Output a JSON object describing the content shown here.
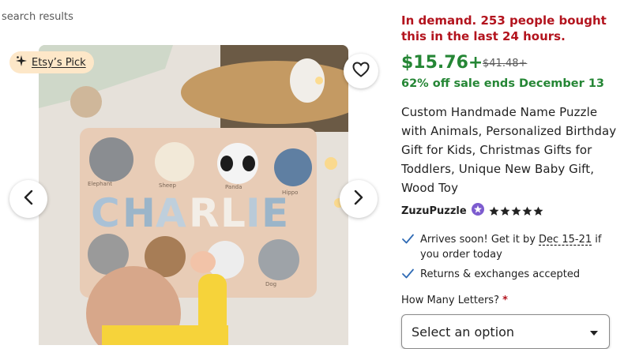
{
  "breadcrumb": "search results",
  "badge": {
    "label": "Etsy’s Pick",
    "icon": "sparkle-icon"
  },
  "image": {
    "alt": "Custom handmade name puzzle with animals",
    "puzzle_name": [
      "C",
      "H",
      "A",
      "R",
      "L",
      "I",
      "E"
    ],
    "animal_labels": [
      "Elephant",
      "Sheep",
      "Panda",
      "Hippo",
      "Dog"
    ]
  },
  "listing": {
    "demand": "In demand. 253 people bought this in the last 24 hours.",
    "price": "$15.76+",
    "original_price": "$41.48+",
    "sale": "62% off sale ends December 13",
    "title": "Custom Handmade Name Puzzle with Animals, Personalized Birthday Gift for Kids, Christmas Gifts for Toddlers, Unique New Baby Gift, Wood Toy",
    "seller": "ZuzuPuzzle",
    "rating": 5
  },
  "shipping": {
    "arrives_prefix": "Arrives soon! Get it by ",
    "arrives_dates": "Dec 15-21",
    "arrives_suffix": " if you order today",
    "returns": "Returns & exchanges accepted"
  },
  "options": {
    "label": "How Many Letters?",
    "required_mark": "*",
    "selected": "Select an option"
  },
  "colors": {
    "demand": "#b3141e",
    "sale": "#258635",
    "badge_bg": "#fde7c8"
  }
}
